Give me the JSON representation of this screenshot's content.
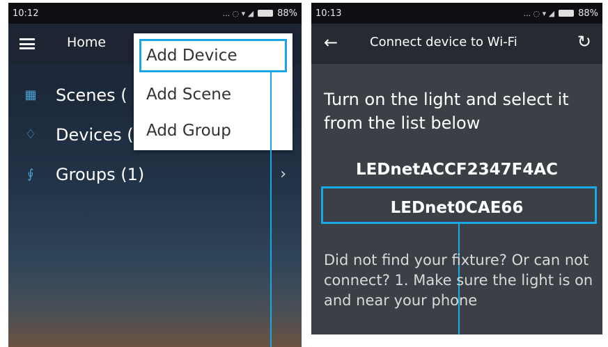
{
  "left_screen": {
    "status": {
      "time": "10:12",
      "icons": "... ◌ ▾ ◢",
      "battery": "88%"
    },
    "appbar": {
      "title": "Home"
    },
    "list": [
      {
        "icon": "scenes-icon",
        "label": "Scenes ("
      },
      {
        "icon": "bulb-icon",
        "label": "Devices ("
      },
      {
        "icon": "groups-icon",
        "label": "Groups (1)",
        "chevron": "›"
      }
    ],
    "menu": {
      "items": [
        "Add Device",
        "Add Scene",
        "Add Group"
      ],
      "highlighted": "Add Device"
    }
  },
  "right_screen": {
    "status": {
      "time": "10:13",
      "icons": "... ◌ ▾ ◢",
      "battery": "88%"
    },
    "appbar": {
      "title": "Connect device to Wi-Fi",
      "back": "←",
      "refresh": "↻"
    },
    "instruction": "Turn on the light and select it from the list below",
    "devices": [
      "LEDnetACCF2347F4AC",
      "LEDnet0CAE66"
    ],
    "highlighted_device": "LEDnet0CAE66",
    "help_text": "Did not find your fixture? Or can not connect? 1. Make sure the light is on and near your phone"
  },
  "colors": {
    "highlight": "#19a7e6",
    "accent_icon": "#4aa3d8"
  }
}
